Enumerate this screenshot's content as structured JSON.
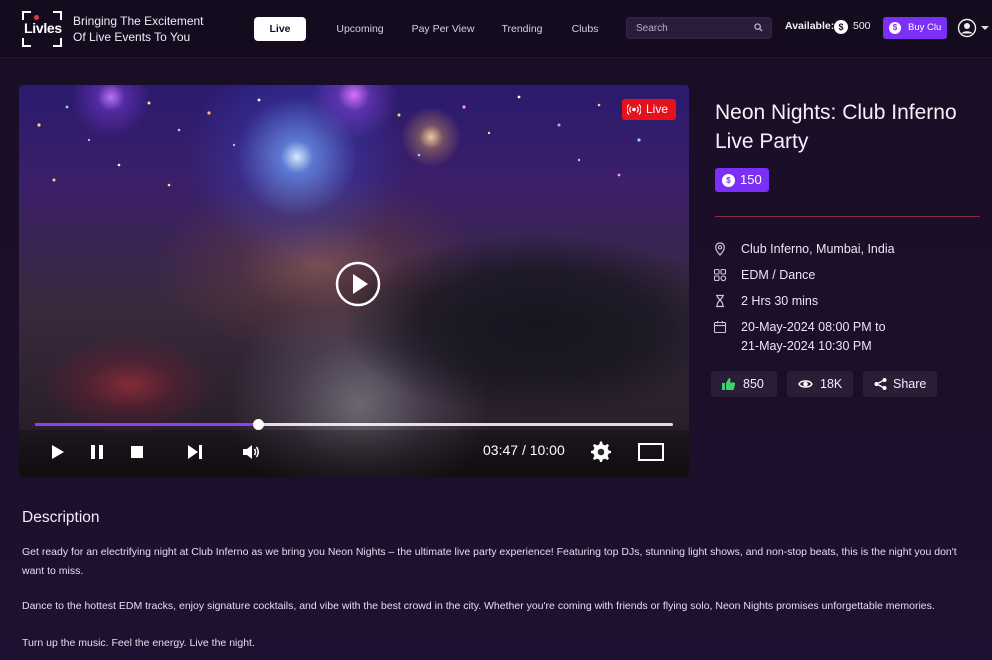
{
  "brand": {
    "logo_text": "Livles",
    "tagline": "Bringing The Excitement Of Live Events To You"
  },
  "nav": {
    "items": [
      "Live",
      "Upcoming",
      "Pay Per View",
      "Trending",
      "Clubs"
    ],
    "active": "Live"
  },
  "search": {
    "placeholder": "Search"
  },
  "wallet": {
    "available_label": "Available:",
    "coin_symbol": "$",
    "balance": "500",
    "buy_label": "Buy Clu"
  },
  "player": {
    "live_label": "Live",
    "current_time": "03:47",
    "separator": "/",
    "duration": "10:00",
    "progress": 0.35
  },
  "event": {
    "title": "Neon Nights: Club Inferno Live Party",
    "price": "150",
    "location": "Club Inferno, Mumbai, India",
    "genre": "EDM / Dance",
    "duration": "2 Hrs 30 mins",
    "date_line1": "20-May-2024 08:00 PM to",
    "date_line2": "21-May-2024 10:30 PM",
    "likes": "850",
    "views": "18K",
    "share_label": "Share"
  },
  "description": {
    "heading": "Description",
    "paragraphs": [
      "Get ready for an electrifying night at Club Inferno as we bring you Neon Nights – the ultimate live party experience! Featuring top DJs, stunning light shows, and non-stop beats, this is the night you don't want to miss.",
      "Dance to the hottest EDM tracks, enjoy signature cocktails, and vibe with the best crowd in the city. Whether you're coming with friends or flying solo, Neon Nights promises unforgettable memories.",
      "Turn up the music. Feel the energy. Live the night."
    ]
  },
  "colors": {
    "accent": "#7b2ff7",
    "live_red": "#e3121d",
    "background": "#1a0e26"
  }
}
